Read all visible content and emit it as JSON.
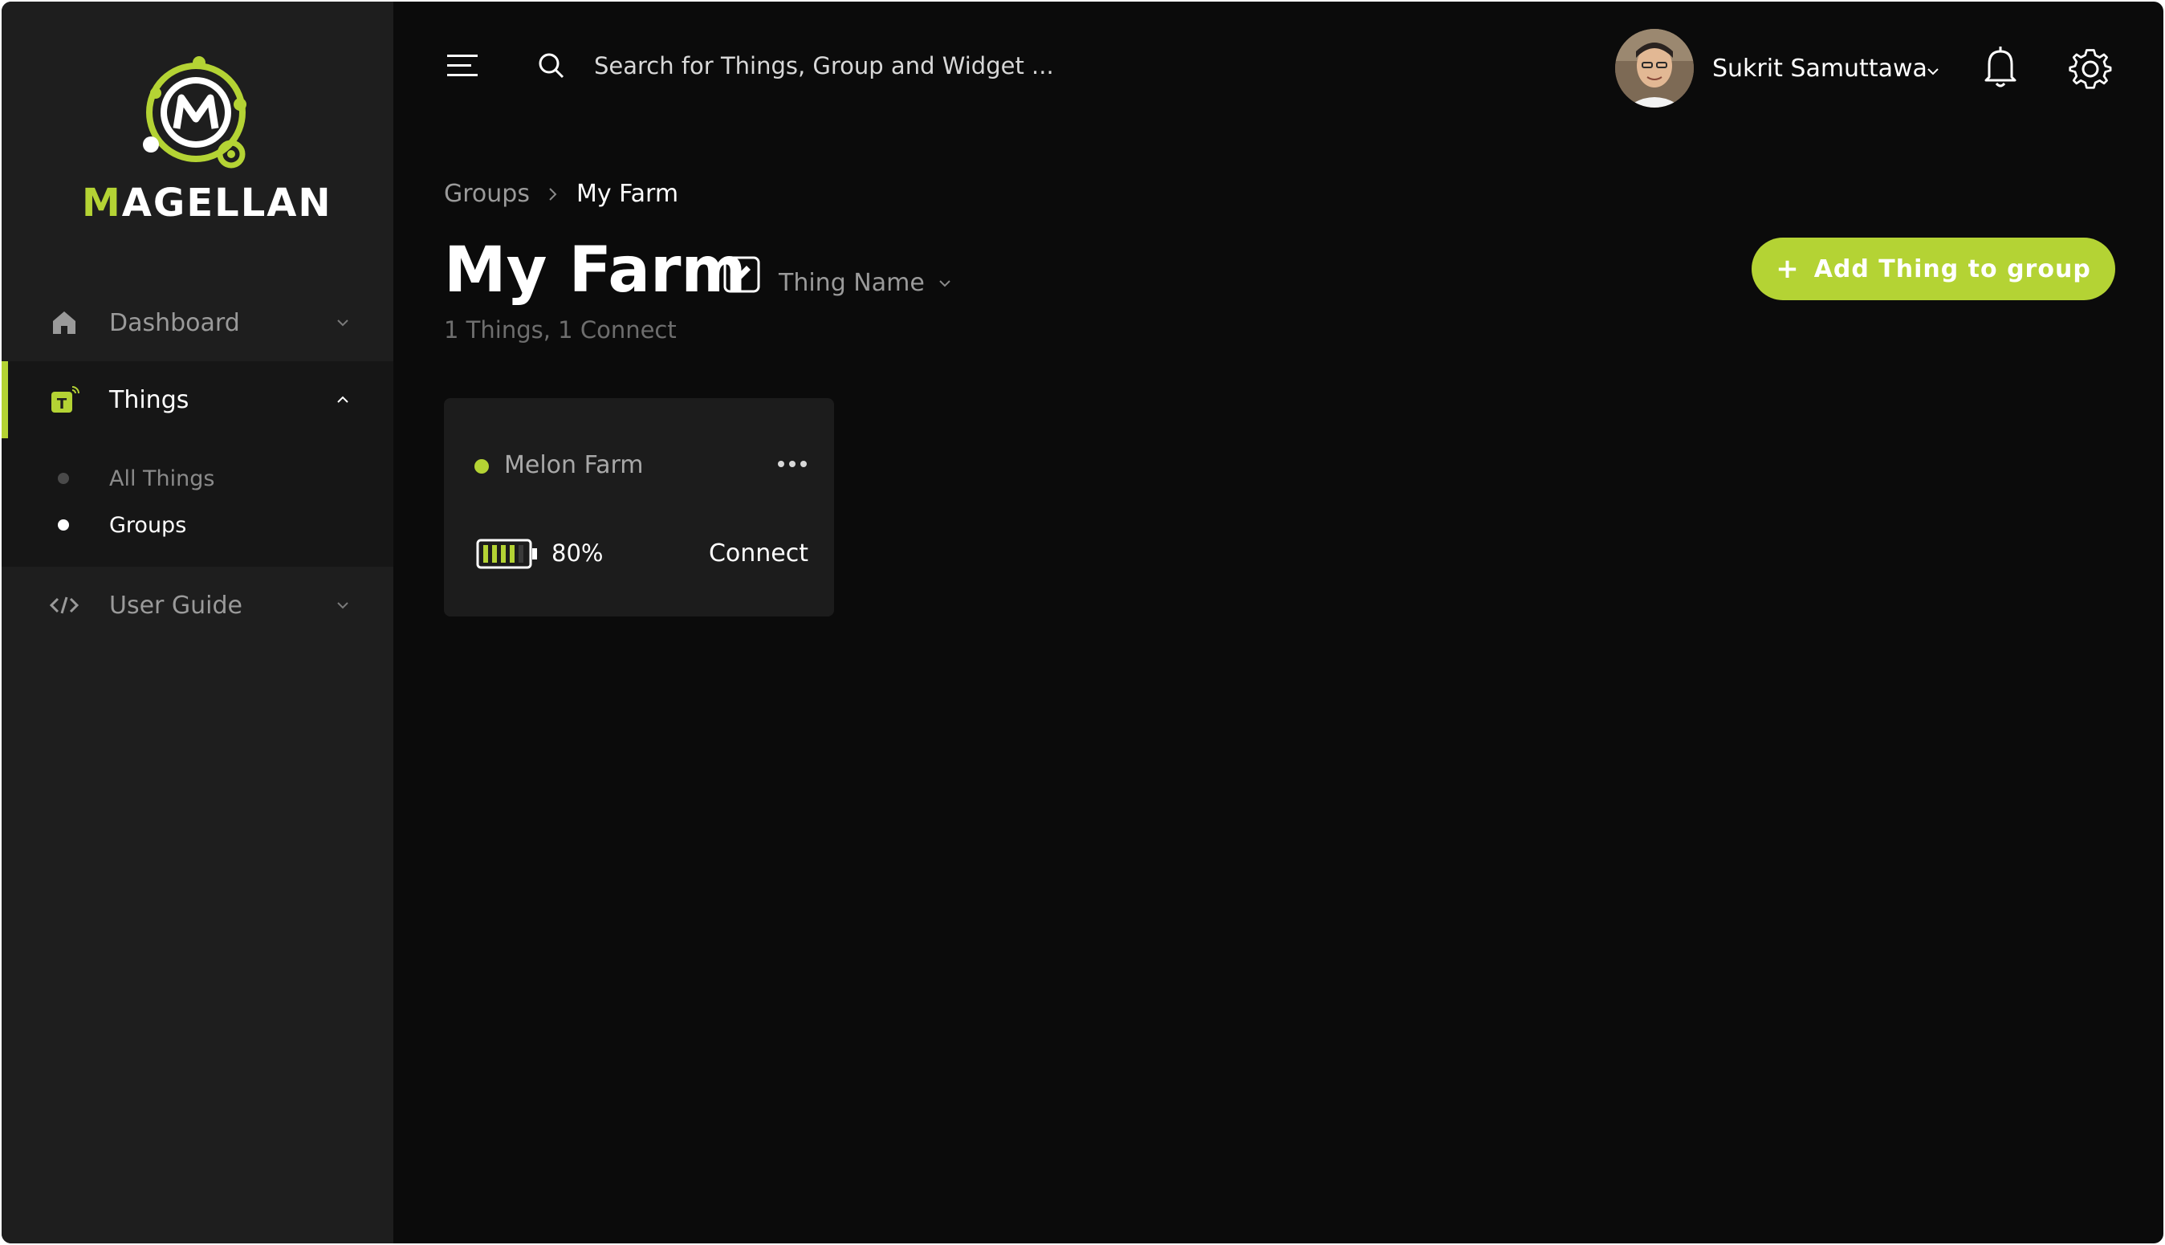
{
  "brand": {
    "name_first": "M",
    "name_rest": "AGELLAN",
    "accent_color": "#b4d334"
  },
  "sidebar": {
    "items": [
      {
        "label": "Dashboard",
        "icon": "home-icon",
        "expanded": false
      },
      {
        "label": "Things",
        "icon": "things-icon",
        "expanded": true,
        "active": true
      },
      {
        "label": "User Guide",
        "icon": "code-icon",
        "expanded": false
      }
    ],
    "things_sub": [
      {
        "label": "All Things",
        "active": false
      },
      {
        "label": "Groups",
        "active": true
      }
    ]
  },
  "header": {
    "search_placeholder": "Search for Things, Group and Widget ...",
    "user_name": "Sukrit Samuttawa"
  },
  "main": {
    "breadcrumb": [
      {
        "label": "Groups"
      },
      {
        "label": "My Farm"
      }
    ],
    "title": "My Farm",
    "sort_label": "Thing Name",
    "summary": "1 Things, 1 Connect",
    "add_button_plus": "+",
    "add_button_label": "Add Thing to group",
    "cards": [
      {
        "name": "Melon Farm",
        "battery_percent": "80%",
        "battery_level": 0.8,
        "status": "Connect",
        "status_color": "#b4d334"
      }
    ]
  }
}
